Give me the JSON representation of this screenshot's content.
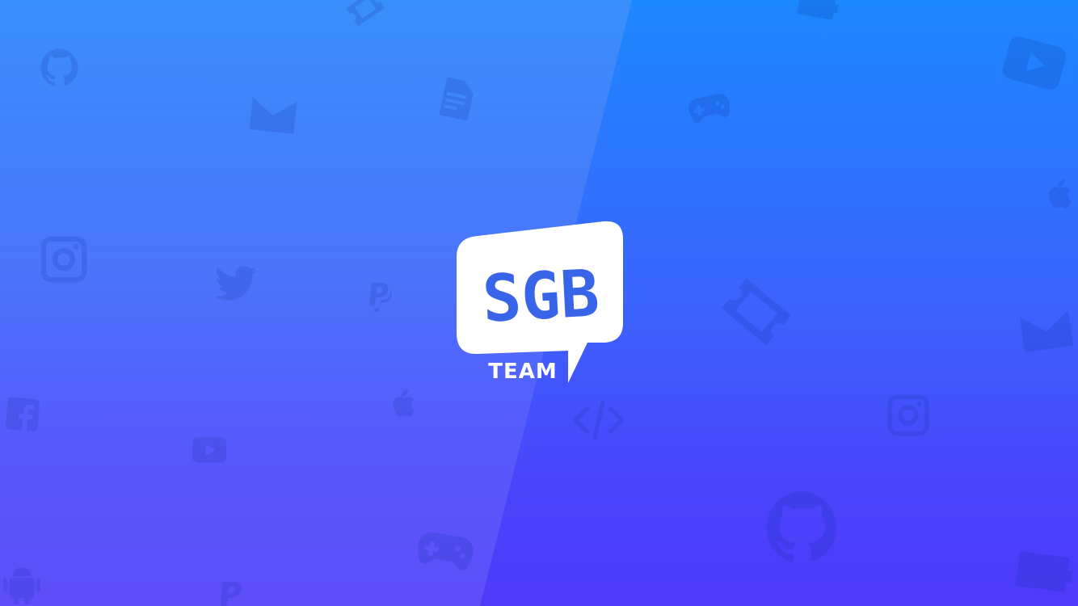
{
  "brand": {
    "main_text": "SGB",
    "sub_text": "TEAM"
  },
  "colors": {
    "bg_left_top": "#3a8ffc",
    "bg_left_bottom": "#5e4dfa",
    "bg_right_top": "#1c88fe",
    "bg_right_bottom": "#4e3af9",
    "logo_fill": "#ffffff",
    "logo_text": "#3864e8"
  },
  "background_icons": [
    "github-icon",
    "mail-icon",
    "document-icon",
    "ticket-icon",
    "gamepad-icon",
    "wallet-icon",
    "youtube-icon",
    "apple-icon",
    "instagram-icon",
    "twitter-icon",
    "paypal-icon",
    "facebook-icon",
    "code-icon",
    "android-icon"
  ]
}
